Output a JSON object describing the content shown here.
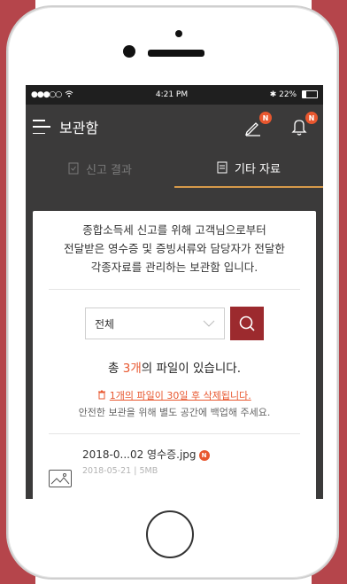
{
  "status_bar": {
    "time": "4:21 PM",
    "battery": "22%"
  },
  "app_bar": {
    "title": "보관함",
    "edit_badge": "N",
    "bell_badge": "N"
  },
  "tabs": [
    {
      "label": "신고 결과"
    },
    {
      "label": "기타 자료"
    }
  ],
  "intro": {
    "line1": "종합소득세 신고를 위해 고객님으로부터",
    "line2": "전달받은 영수증 및 증빙서류와 담당자가 전달한",
    "line3": "각종자료를 관리하는 보관함 입니다."
  },
  "filter": {
    "selected": "전체"
  },
  "count": {
    "prefix": "총 ",
    "num": "3개",
    "suffix": "의 파일이 있습니다."
  },
  "warning": {
    "link": "1개의 파일이 30일 후 삭제됩니다.",
    "sub": "안전한 보관을 위해 별도 공간에 백업해 주세요."
  },
  "file": {
    "name": "2018-0...02 영수증.jpg",
    "badge": "N",
    "meta": "2018-05-21 | 5MB"
  },
  "colors": {
    "accent": "#e8572f",
    "search_button": "#9c2a2e",
    "tab_underline": "#d69a4a",
    "background": "#b5454b"
  },
  "icons": [
    "hamburger-icon",
    "pen-icon",
    "bell-icon",
    "document-icon",
    "search-icon",
    "chevron-down-icon",
    "trash-icon",
    "image-icon"
  ]
}
